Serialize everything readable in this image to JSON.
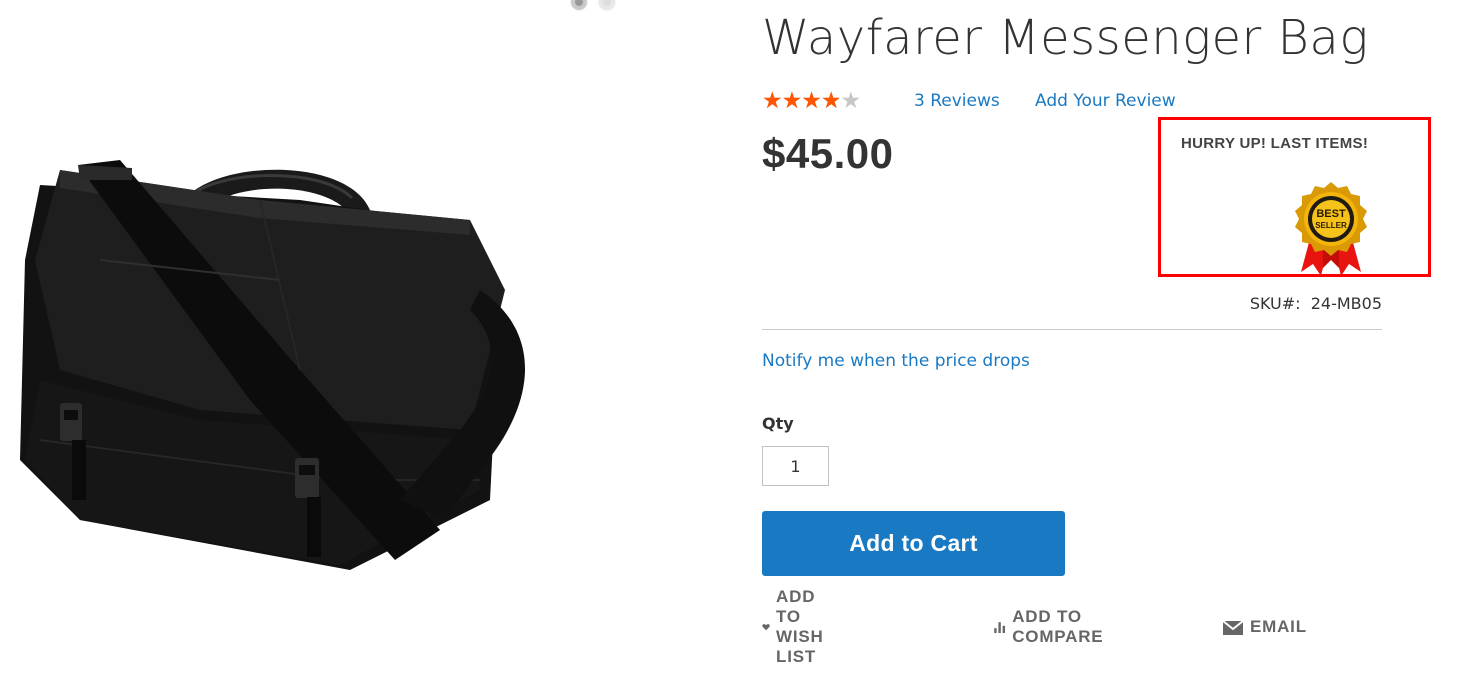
{
  "product": {
    "title": "Wayfarer Messenger Bag",
    "rating": {
      "value": 3.5,
      "max": 5,
      "star_glyphs": "★★★★★"
    },
    "reviews_link_label": "3 Reviews",
    "add_review_label": "Add Your Review",
    "price": "$45.00",
    "sku_label": "SKU#:",
    "sku_value": "24-MB05",
    "image_icon": "messenger-bag-photo"
  },
  "gallery": {
    "dots": [
      {
        "active": true
      },
      {
        "active": false
      }
    ]
  },
  "promo": {
    "title": "HURRY UP! LAST ITEMS!",
    "badge": {
      "line1": "BEST",
      "line2": "SELLER",
      "icon": "best-seller-badge-icon"
    },
    "border_color": "#ff0000"
  },
  "notify": {
    "label": "Notify me when the price drops"
  },
  "qty": {
    "label": "Qty",
    "value": "1"
  },
  "cart": {
    "button_label": "Add to Cart"
  },
  "actions": [
    {
      "label": "ADD TO WISH LIST",
      "icon": "heart-icon"
    },
    {
      "label": "ADD TO COMPARE",
      "icon": "compare-bars-icon"
    },
    {
      "label": "EMAIL",
      "icon": "envelope-icon"
    }
  ],
  "colors": {
    "accent": "#1979c3",
    "star": "#ff5501",
    "star_empty": "#c7c7c7",
    "text": "#333333",
    "action_text": "#666666"
  }
}
